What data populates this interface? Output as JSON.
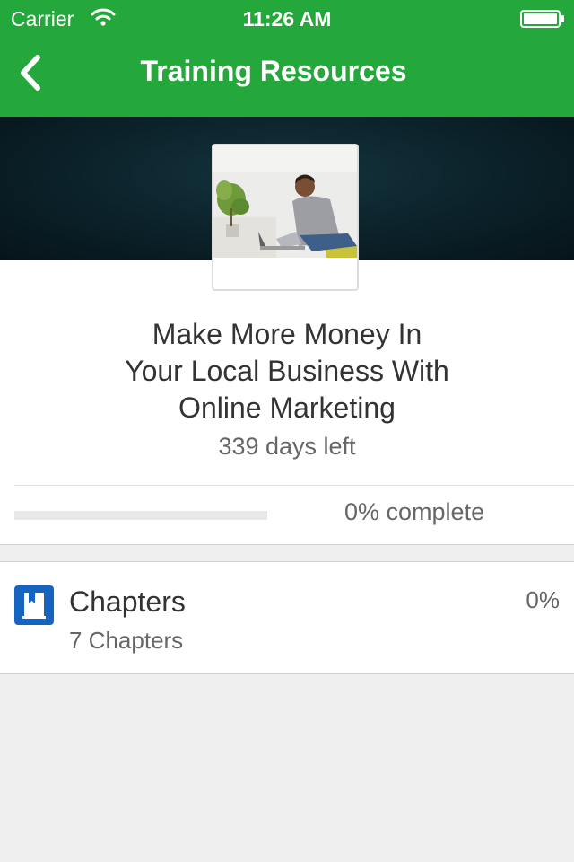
{
  "status_bar": {
    "carrier": "Carrier",
    "time": "11:26 AM",
    "wifi_icon": "wifi-icon",
    "battery_icon": "battery-full-icon"
  },
  "nav": {
    "title": "Training Resources",
    "back_icon": "chevron-left-icon"
  },
  "course": {
    "title": "Make More Money In\nYour Local Business With\nOnline Marketing",
    "days_left": "339 days left",
    "progress_percent": 0,
    "progress_label": "0% complete"
  },
  "sections": [
    {
      "name": "Chapters",
      "count": "7 Chapters",
      "percent": "0%",
      "icon": "book-icon"
    }
  ],
  "colors": {
    "brand_green": "#25a83b",
    "icon_blue": "#1565c0"
  }
}
